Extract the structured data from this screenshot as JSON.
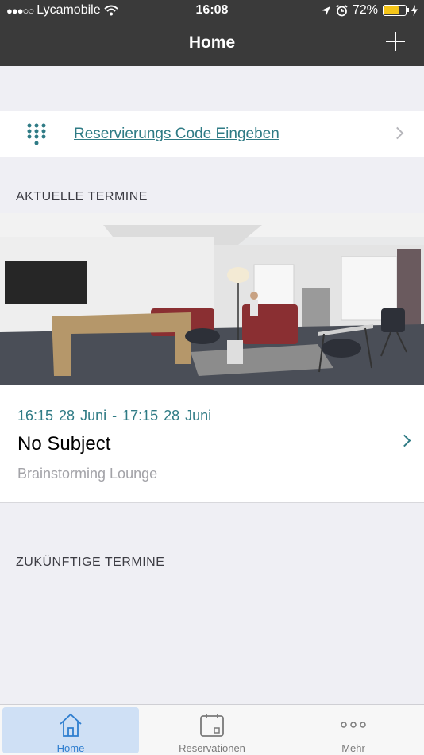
{
  "status_bar": {
    "signal_dots": "●●●○○",
    "carrier": "Lycamobile",
    "time": "16:08",
    "battery": "72%",
    "battery_level": 0.72
  },
  "nav": {
    "title": "Home",
    "add_icon": "plus-icon"
  },
  "code_row": {
    "icon": "keypad-icon",
    "label": "Reservierungs Code Eingeben"
  },
  "sections": {
    "current": "AKTUELLE TERMINE",
    "future": "ZUKÜNFTIGE TERMINE"
  },
  "booking": {
    "time": "16:15  28 Juni - 17:15  28 Juni",
    "subject": "No Subject",
    "room": "Brainstorming Lounge"
  },
  "tabs": [
    {
      "label": "Home",
      "icon": "house-icon",
      "active": true
    },
    {
      "label": "Reservationen",
      "icon": "calendar-icon",
      "active": false
    },
    {
      "label": "Mehr",
      "icon": "more-dots-icon",
      "active": false
    }
  ],
  "colors": {
    "nav_bg": "#3a3a3a",
    "accent": "#2f7b85",
    "tab_active": "#2f7ecf",
    "background": "#efeff4"
  }
}
